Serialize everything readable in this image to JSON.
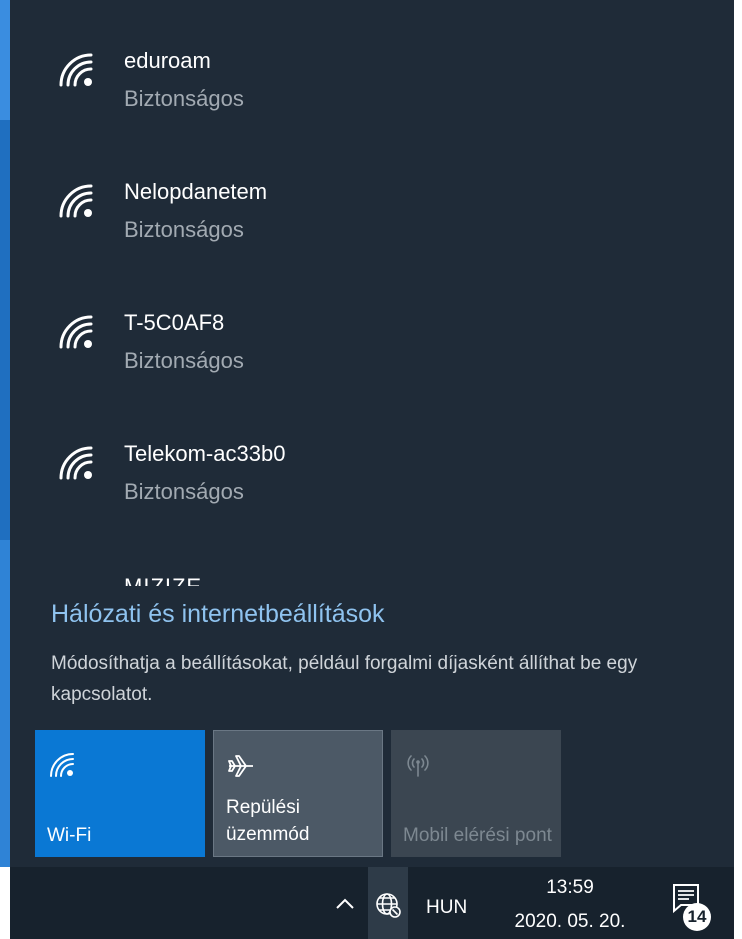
{
  "networks": [
    {
      "name": "eduroam",
      "status": "Biztonságos",
      "icon": "wifi-signal-icon"
    },
    {
      "name": "Nelopdanetem",
      "status": "Biztonságos",
      "icon": "wifi-signal-icon"
    },
    {
      "name": "T-5C0AF8",
      "status": "Biztonságos",
      "icon": "wifi-signal-icon"
    },
    {
      "name": "Telekom-ac33b0",
      "status": "Biztonságos",
      "icon": "wifi-signal-icon"
    }
  ],
  "cut_off_item": "MIZIZE",
  "settings": {
    "link": "Hálózati és internetbeállítások",
    "description": "Módosíthatja a beállításokat, például forgalmi díjasként állíthat be egy kapcsolatot."
  },
  "quick_actions": [
    {
      "label": "Wi-Fi",
      "icon": "wifi-icon",
      "state": "on",
      "color": "#0a78d4"
    },
    {
      "label": "Repülési üzemmód",
      "icon": "airplane-icon",
      "state": "off",
      "color": "#4c5966"
    },
    {
      "label": "Mobil elérési pont",
      "icon": "hotspot-icon",
      "state": "disabled",
      "color": "#3b4651"
    }
  ],
  "taskbar": {
    "language": "HUN",
    "time": "13:59",
    "date": "2020. 05. 20.",
    "notification_count": "14"
  },
  "colors": {
    "flyout_bg": "#1f2b38",
    "accent": "#0a78d4",
    "link": "#8fc3ef"
  }
}
